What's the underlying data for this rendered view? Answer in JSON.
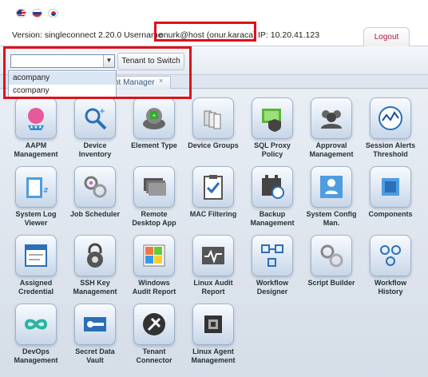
{
  "header": {
    "version_text": "Version: singleconnect 2.20.0  Username",
    "user": "onurk@host (onur.karaca)",
    "ip_text": "IP: 10.20.41.123",
    "logout_label": "Logout"
  },
  "toolbar": {
    "tenant_value": "",
    "switch_label": "Tenant to Switch"
  },
  "dropdown": {
    "options": [
      "acompany",
      "ccompany"
    ]
  },
  "tab": {
    "label": "nt Manager",
    "close": "×"
  },
  "apps": [
    {
      "label": "AAPM Management",
      "l1": "AAPM",
      "l2": "Management"
    },
    {
      "label": "Device Inventory",
      "l1": "Device",
      "l2": "Inventory"
    },
    {
      "label": "Element Type",
      "l1": "Element Type",
      "l2": ""
    },
    {
      "label": "Device Groups",
      "l1": "Device Groups",
      "l2": ""
    },
    {
      "label": "SQL Proxy Policy",
      "l1": "SQL Proxy",
      "l2": "Policy"
    },
    {
      "label": "Approval Management",
      "l1": "Approval",
      "l2": "Management"
    },
    {
      "label": "Session Alerts Threshold",
      "l1": "Session Alerts",
      "l2": "Threshold"
    },
    {
      "label": "System Log Viewer",
      "l1": "System Log",
      "l2": "Viewer"
    },
    {
      "label": "Job Scheduler",
      "l1": "Job Scheduler",
      "l2": ""
    },
    {
      "label": "Remote Desktop App",
      "l1": "Remote",
      "l2": "Desktop App"
    },
    {
      "label": "MAC Filtering",
      "l1": "MAC Filtering",
      "l2": ""
    },
    {
      "label": "Backup Management",
      "l1": "Backup",
      "l2": "Management"
    },
    {
      "label": "System Config Man.",
      "l1": "System Config",
      "l2": "Man."
    },
    {
      "label": "Components",
      "l1": "Components",
      "l2": ""
    },
    {
      "label": "Assigned Credential",
      "l1": "Assigned",
      "l2": "Credential"
    },
    {
      "label": "SSH Key Management",
      "l1": "SSH Key",
      "l2": "Management"
    },
    {
      "label": "Windows Audit Report",
      "l1": "Windows",
      "l2": "Audit Report"
    },
    {
      "label": "Linux Audit Report",
      "l1": "Linux Audit",
      "l2": "Report"
    },
    {
      "label": "Workflow Designer",
      "l1": "Workflow",
      "l2": "Designer"
    },
    {
      "label": "Script Builder",
      "l1": "Script Builder",
      "l2": ""
    },
    {
      "label": "Workflow History",
      "l1": "Workflow",
      "l2": "History"
    },
    {
      "label": "DevOps Management",
      "l1": "DevOps",
      "l2": "Management"
    },
    {
      "label": "Secret Data Vault",
      "l1": "Secret Data",
      "l2": "Vault"
    },
    {
      "label": "Tenant Connector",
      "l1": "Tenant",
      "l2": "Connector"
    },
    {
      "label": "Linux Agent Management",
      "l1": "Linux Agent",
      "l2": "Management"
    }
  ],
  "colors": {
    "highlight": "#e0101a",
    "logout": "#b01b4a"
  }
}
